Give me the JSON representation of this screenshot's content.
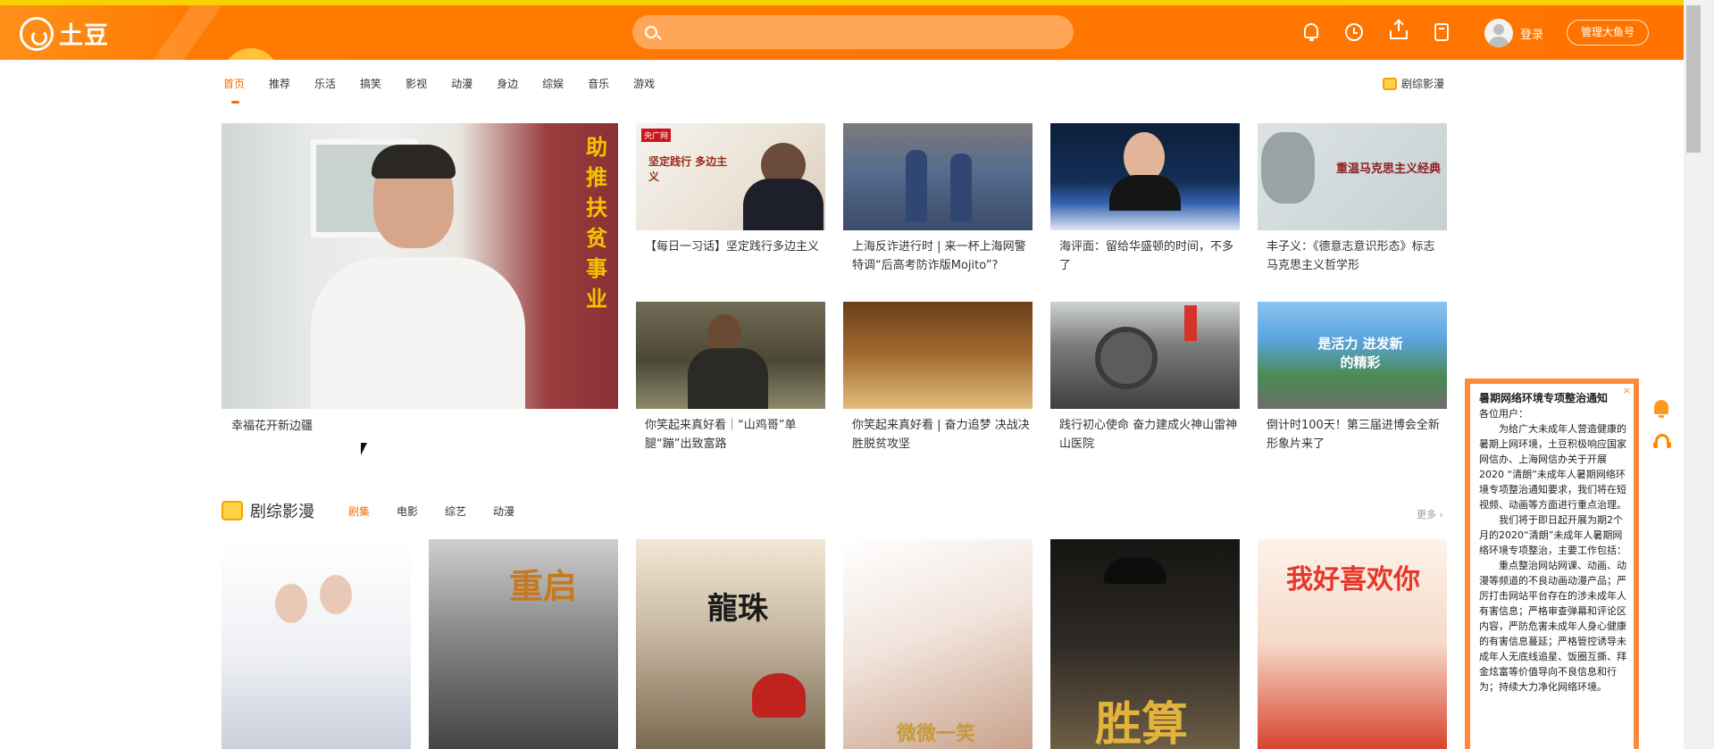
{
  "header": {
    "logo_text": "土豆",
    "search_placeholder": "",
    "login_label": "登录",
    "manage_button": "管理大鱼号"
  },
  "nav": {
    "items": [
      "首页",
      "推荐",
      "乐活",
      "搞笑",
      "影视",
      "动漫",
      "身边",
      "综娱",
      "音乐",
      "游戏"
    ],
    "active_index": 0,
    "right_label": "剧综影漫"
  },
  "hero": {
    "caption": "幸福花开新边疆",
    "overlay_text": "助推扶贫事业"
  },
  "thumbs": [
    {
      "caption": "【每日一习话】坚定践行多边主义",
      "badge": "央广网",
      "overlay": "坚定践行 多边主义"
    },
    {
      "caption": "上海反诈进行时 | 来一杯上海网警特调“后高考防诈版Mojito”?",
      "badge": "",
      "overlay": ""
    },
    {
      "caption": "海评面：留给华盛顿的时间，不多了",
      "badge": "",
      "overlay": ""
    },
    {
      "caption": "丰子义：《德意志意识形态》标志马克思主义哲学形",
      "badge": "",
      "overlay": "重温马克思主义经典"
    },
    {
      "caption": "你笑起来真好看｜“山鸡哥”单腿“蹦”出致富路",
      "badge": "",
      "overlay": ""
    },
    {
      "caption": "你笑起来真好看 | 奋力追梦 决战决胜脱贫攻坚",
      "badge": "",
      "overlay": ""
    },
    {
      "caption": "践行初心使命 奋力建成火神山雷神山医院",
      "badge": "",
      "overlay": ""
    },
    {
      "caption": "倒计时100天！第三届进博会全新形象片来了",
      "badge": "",
      "overlay": "是活力 进发新的精彩"
    }
  ],
  "section": {
    "title": "剧综影漫",
    "tabs": [
      "剧集",
      "电影",
      "综艺",
      "动漫"
    ],
    "active_index": 0,
    "more_label": "更多 ›"
  },
  "posters": [
    {
      "overlay": ""
    },
    {
      "overlay": "重启"
    },
    {
      "overlay": "龍珠"
    },
    {
      "overlay": "微微一笑"
    },
    {
      "overlay": "胜算"
    },
    {
      "overlay": "我好喜欢你"
    }
  ],
  "notice": {
    "close": "×",
    "title": "暑期网络环境专项整治通知",
    "greeting": "各位用户：",
    "paragraphs": [
      "为给广大未成年人营造健康的暑期上网环境，土豆积极响应国家网信办、上海网信办关于开展2020 “清朗”未成年人暑期网络环境专项整治通知要求，我们将在短视频、动画等方面进行重点治理。",
      "我们将于即日起开展为期2个月的2020“清朗”未成年人暑期网络环境专项整治，主要工作包括：",
      "重点整治网站网课、动画、动漫等频道的不良动画动漫产品；严厉打击网站平台存在的涉未成年人有害信息；严格审查弹幕和评论区内容，严防危害未成年人身心健康的有害信息蔓延；严格管控诱导未成年人无底线追星、饭圈互撕、拜金炫富等价值导向不良信息和行为；持续大力净化网络环境。"
    ]
  }
}
